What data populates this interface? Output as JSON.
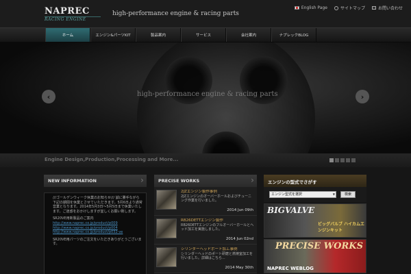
{
  "brand": {
    "name": "NAPREC",
    "sub": "RACING ENGINE",
    "tagline": "high-performance engine & racing parts"
  },
  "toplinks": [
    {
      "label": "English Page",
      "icon": "flag-icon"
    },
    {
      "label": "サイトマップ",
      "icon": "share-icon"
    },
    {
      "label": "お問い合わせ",
      "icon": "mail-icon"
    }
  ],
  "nav": [
    {
      "label": "ホーム",
      "active": true
    },
    {
      "label": "エンジン&パーツKIT"
    },
    {
      "label": "製品案内"
    },
    {
      "label": "サービス"
    },
    {
      "label": "会社案内"
    },
    {
      "label": "ナプレックBLOG"
    }
  ],
  "hero": {
    "caption": "high-performance engine & racing parts",
    "prev": "‹",
    "next": "›",
    "slide_count": 5,
    "active_slide": 1
  },
  "strip": {
    "text": "Engine Design,Production,Processing and More..."
  },
  "info": {
    "heading": "NEW INFORMATION",
    "p1": "///ゴールデンウィーク休業のお知らせ///\n誠に勝手ながら下記の期間を休業とさせていただきます。5月6日より通常営業となります。2014年5月3日〜5月5日まで休業いたします。ご迷惑をおかけしますが宜しくお願い致します。",
    "p2_label": "SR20VE用新製品のご案内",
    "link1": "http://www.naprec.co.jp/product/p009",
    "link2": "http://www.naprec.co.jp/product/p004",
    "link3": "http://www.naprec.co.jp/product/p032-ve",
    "p3": "SR20VE用パーツのご注文をいただきありがとうございます。"
  },
  "works": {
    "heading": "PRECISE WORKS",
    "items": [
      {
        "title": "2JZエンジン製作事例",
        "body": "2JZエンジンのオーバーホールおよびチューニング作業を行いました。",
        "date": "2014 Jun 09th"
      },
      {
        "title": "RB26DETTエンジン製作",
        "body": "RB26DETTエンジンのフルオーバーホールとヘッド加工を実施しました。",
        "date": "2014 Jun 02nd"
      },
      {
        "title": "シリンダーヘッドポート加工事例",
        "body": "シリンダーヘッドのポート研磨と燃焼室加工を行いました。詳細はこちら...",
        "date": "2014 May 30th"
      }
    ]
  },
  "search": {
    "heading": "エンジンの型式でさがす",
    "select_value": "エンジン型式を選択",
    "button": "検索"
  },
  "banners": {
    "b1_main": "BIGVALVE",
    "b1_jp": "ビッグバルブ ハイカムエンジンキット",
    "b2_left": "NAPREC WEBLOG",
    "b2_right": "PRECISE WORKS"
  }
}
